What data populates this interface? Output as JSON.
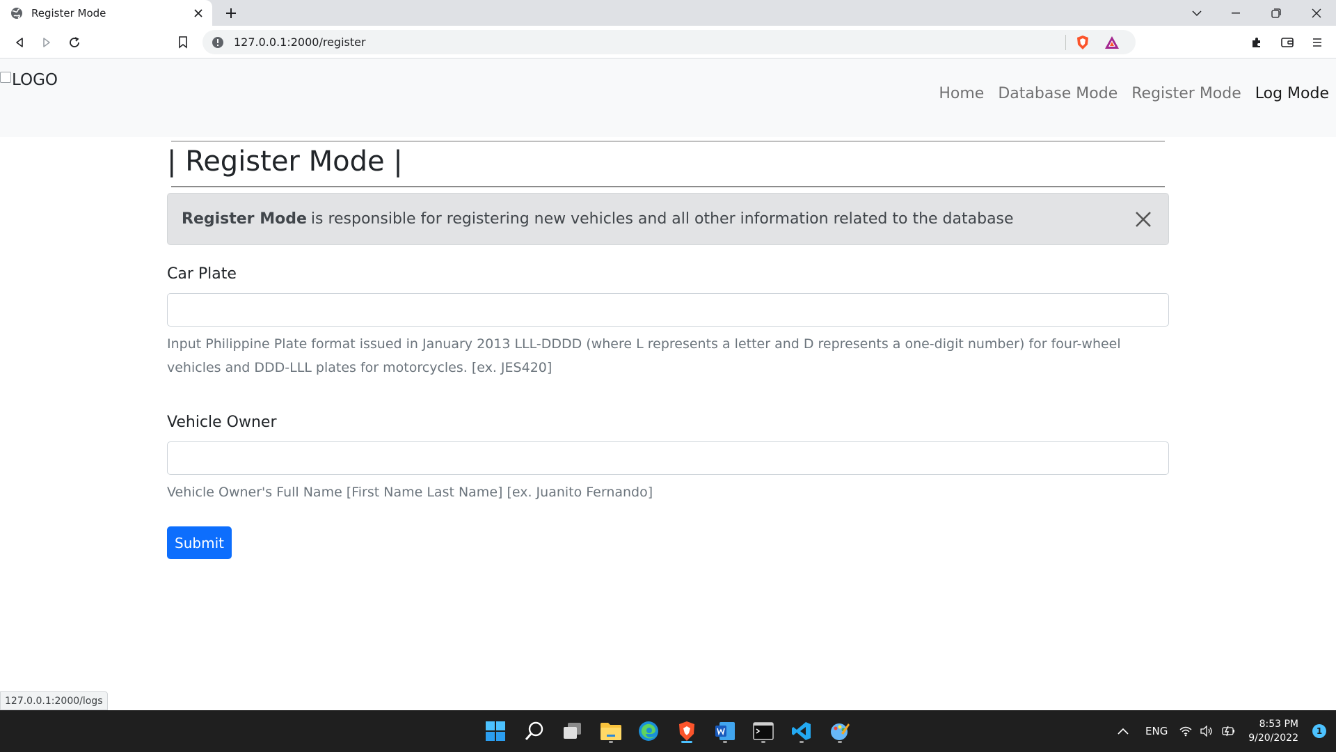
{
  "browser": {
    "tab_title": "Register Mode",
    "url": "127.0.0.1:2000/register",
    "status_url": "127.0.0.1:2000/logs"
  },
  "navbar": {
    "logo_alt": "LOGO",
    "links": [
      {
        "label": "Home"
      },
      {
        "label": "Database Mode"
      },
      {
        "label": "Register Mode"
      },
      {
        "label": "Log Mode"
      }
    ]
  },
  "page": {
    "title": "| Register Mode |",
    "alert": {
      "strong": "Register Mode",
      "text": "is responsible for registering new vehicles and all other information related to the database"
    },
    "form": {
      "car_plate": {
        "label": "Car Plate",
        "value": "",
        "help": "Input Philippine Plate format issued in January 2013 LLL-DDDD (where L represents a letter and D represents a one-digit number) for four-wheel vehicles and DDD-LLL plates for motorcycles. [ex. JES420]"
      },
      "vehicle_owner": {
        "label": "Vehicle Owner",
        "value": "",
        "help": "Vehicle Owner's Full Name [First Name Last Name] [ex. Juanito Fernando]"
      },
      "submit_label": "Submit"
    }
  },
  "taskbar": {
    "apps": [
      "start-icon",
      "search-icon",
      "task-view-icon",
      "file-explorer-icon",
      "edge-icon",
      "brave-icon",
      "word-icon",
      "terminal-icon",
      "vscode-icon",
      "paint-icon"
    ],
    "language": "ENG",
    "time": "8:53 PM",
    "date": "9/20/2022",
    "notifications": "1"
  },
  "colors": {
    "primary": "#0d6efd",
    "navbar_bg": "#f8f9fa",
    "alert_bg": "#e2e3e5",
    "taskbar_bg": "#1f1f1f"
  }
}
